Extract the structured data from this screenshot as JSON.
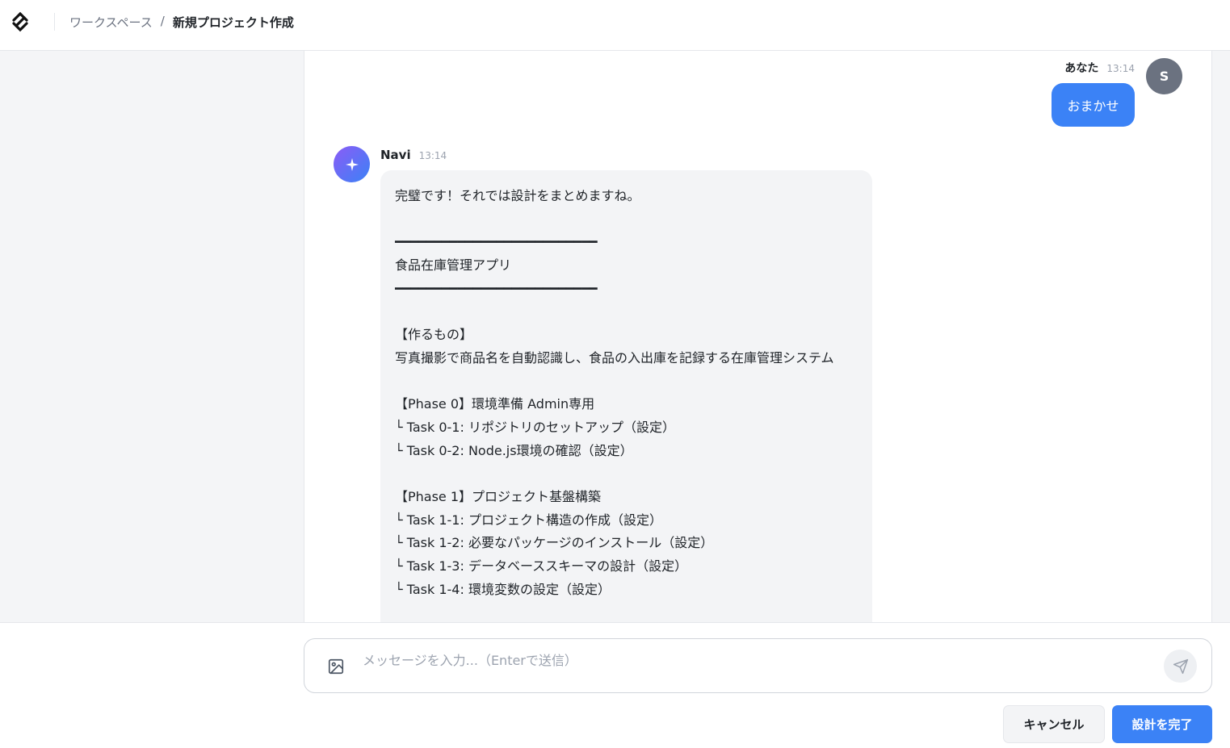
{
  "header": {
    "breadcrumb": {
      "parent": "ワークスペース",
      "separator": "/",
      "current": "新規プロジェクト作成"
    }
  },
  "chat": {
    "user_message": {
      "author": "あなた",
      "time": "13:14",
      "avatar_initial": "S",
      "text": "おまかせ"
    },
    "navi_message": {
      "author": "Navi",
      "time": "13:14",
      "lines": [
        "完璧です！それでは設計をまとめますね。",
        "",
        "━━━━━━━━━━━━━━━━━━━━━━━━━━",
        "食品在庫管理アプリ",
        "━━━━━━━━━━━━━━━━━━━━━━━━━━",
        "",
        "【作るもの】",
        "写真撮影で商品名を自動認識し、食品の入出庫を記録する在庫管理システム",
        "",
        "【Phase 0】環境準備 Admin専用",
        "└ Task 0-1: リポジトリのセットアップ（設定）",
        "└ Task 0-2: Node.js環境の確認（設定）",
        "",
        "【Phase 1】プロジェクト基盤構築",
        "└ Task 1-1: プロジェクト構造の作成（設定）",
        "└ Task 1-2: 必要なパッケージのインストール（設定）",
        "└ Task 1-3: データベーススキーマの設計（設定）",
        "└ Task 1-4: 環境変数の設定（設定）",
        "",
        ""
      ]
    }
  },
  "composer": {
    "placeholder": "メッセージを入力...（Enterで送信）",
    "value": ""
  },
  "actions": {
    "cancel_label": "キャンセル",
    "finish_label": "設計を完了"
  },
  "colors": {
    "accent": "#3b82f6",
    "user_avatar": "#6b7280",
    "bubble_bg": "#f3f4f6"
  },
  "icons": {
    "logo": "app-logo",
    "navi": "sparkle-icon",
    "attach": "image-icon",
    "send": "send-icon"
  }
}
